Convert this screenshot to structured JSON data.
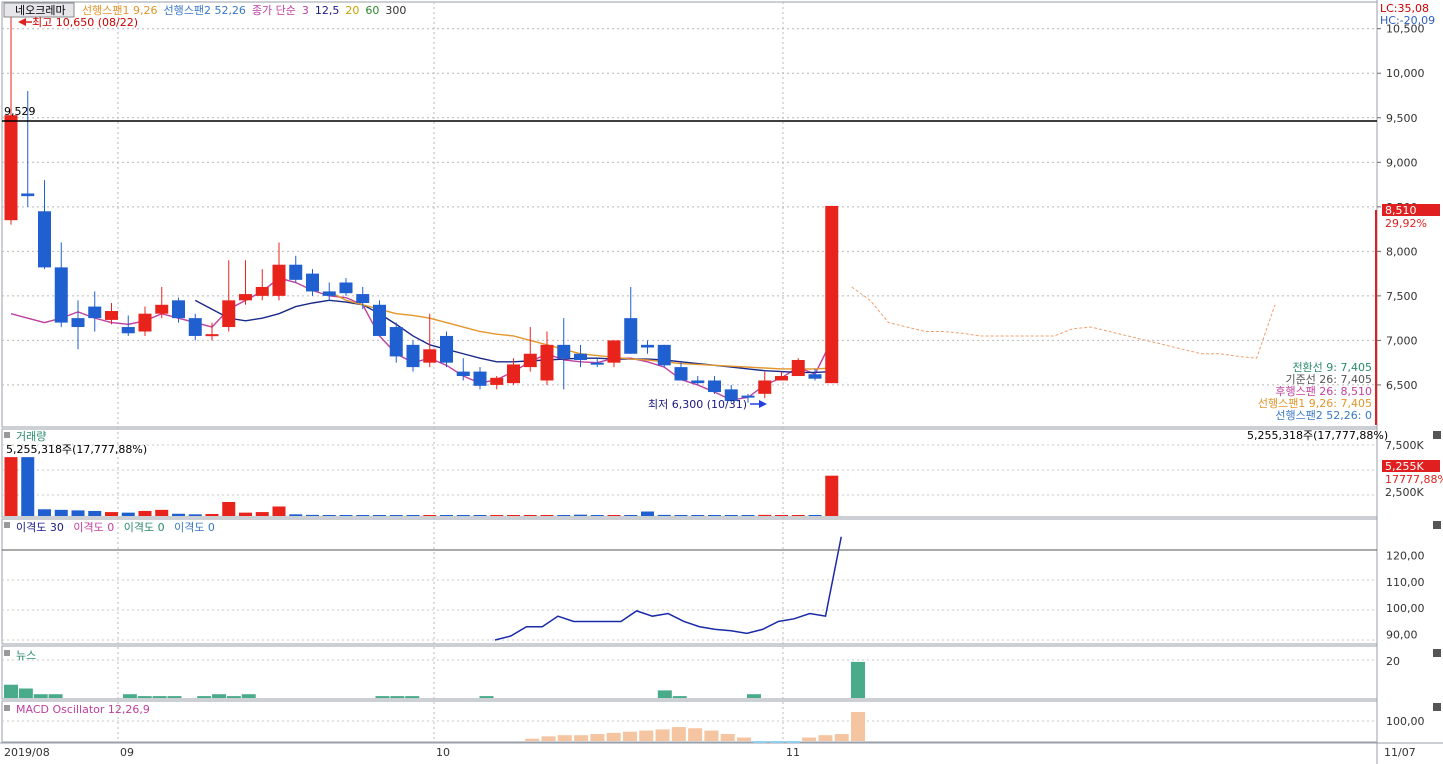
{
  "header": {
    "stock_name": "네오크레마",
    "indicators": [
      {
        "label": "선행스팬1 9,26",
        "color": "#e3962b"
      },
      {
        "label": "선행스팬2 52,26",
        "color": "#3a78c8"
      },
      {
        "label": "종가 단순",
        "color": "#c040a0"
      },
      {
        "label": "3",
        "color": "#c040a0"
      },
      {
        "label": "12,5",
        "color": "#1a1a8a"
      },
      {
        "label": "20",
        "color": "#c8a000"
      },
      {
        "label": "60",
        "color": "#2a8a2a"
      },
      {
        "label": "300",
        "color": "#333333"
      }
    ]
  },
  "annotations": {
    "high": "최고 10,650 (08/22)",
    "low": "최저 6,300 (10/31)",
    "hline_value": "9,529",
    "lc": "LC:35,08",
    "hc": "HC:-20,09",
    "price_tag": "8,510",
    "price_pct": "29,92%"
  },
  "ichimoku_labels": [
    {
      "text": "전환선 9: 7,405",
      "color": "#2a8a6a"
    },
    {
      "text": "기준선 26: 7,405",
      "color": "#555555"
    },
    {
      "text": "후행스팬 26: 8,510",
      "color": "#c040a0"
    },
    {
      "text": "선행스팬1 9,26: 7,405",
      "color": "#e3962b"
    },
    {
      "text": "선행스팬2 52,26: 0",
      "color": "#3a78c8"
    }
  ],
  "panels": {
    "volume": {
      "title": "거래량",
      "left_value": "5,255,318주(17,777,88%)",
      "right_value": "5,255,318주(17,777,88%)",
      "tag": "5,255K",
      "tag_pct": "17777,88%",
      "ticks": [
        "7,500K",
        "2,500K"
      ]
    },
    "disparity": {
      "title_parts": [
        "이격도 30",
        "이격도 0",
        "이격도 0",
        "이격도 0"
      ],
      "ticks": [
        "120,00",
        "110,00",
        "100,00",
        "90,00"
      ]
    },
    "news": {
      "title": "뉴스",
      "ticks": [
        "20"
      ]
    },
    "macd": {
      "title": "MACD Oscillator 12,26,9",
      "ticks": [
        "100,00"
      ]
    }
  },
  "price_axis_ticks": [
    "10,500",
    "10,000",
    "9,500",
    "9,000",
    "8,500",
    "8,000",
    "7,500",
    "7,000",
    "6,500"
  ],
  "date_axis": [
    "2019/08",
    "09",
    "10",
    "11",
    "11/07"
  ],
  "chart_data": {
    "type": "candlestick",
    "y_range": [
      6050,
      10800
    ],
    "candles": [
      {
        "o": 8350,
        "h": 10650,
        "l": 8300,
        "c": 9529
      },
      {
        "o": 8650,
        "h": 9800,
        "l": 8500,
        "c": 8620
      },
      {
        "o": 8450,
        "h": 8800,
        "l": 7800,
        "c": 7820
      },
      {
        "o": 7820,
        "h": 8100,
        "l": 7150,
        "c": 7200
      },
      {
        "o": 7250,
        "h": 7450,
        "l": 6900,
        "c": 7150
      },
      {
        "o": 7380,
        "h": 7550,
        "l": 7100,
        "c": 7250
      },
      {
        "o": 7230,
        "h": 7420,
        "l": 7180,
        "c": 7330
      },
      {
        "o": 7150,
        "h": 7280,
        "l": 7050,
        "c": 7080
      },
      {
        "o": 7100,
        "h": 7380,
        "l": 7050,
        "c": 7300
      },
      {
        "o": 7300,
        "h": 7600,
        "l": 7250,
        "c": 7400
      },
      {
        "o": 7450,
        "h": 7480,
        "l": 7200,
        "c": 7250
      },
      {
        "o": 7250,
        "h": 7300,
        "l": 7000,
        "c": 7050
      },
      {
        "o": 7050,
        "h": 7200,
        "l": 7000,
        "c": 7070
      },
      {
        "o": 7150,
        "h": 7900,
        "l": 7100,
        "c": 7450
      },
      {
        "o": 7450,
        "h": 7900,
        "l": 7400,
        "c": 7520
      },
      {
        "o": 7500,
        "h": 7800,
        "l": 7450,
        "c": 7600
      },
      {
        "o": 7500,
        "h": 8100,
        "l": 7450,
        "c": 7850
      },
      {
        "o": 7850,
        "h": 7950,
        "l": 7650,
        "c": 7680
      },
      {
        "o": 7750,
        "h": 7800,
        "l": 7500,
        "c": 7550
      },
      {
        "o": 7550,
        "h": 7650,
        "l": 7450,
        "c": 7500
      },
      {
        "o": 7650,
        "h": 7700,
        "l": 7500,
        "c": 7530
      },
      {
        "o": 7520,
        "h": 7600,
        "l": 7350,
        "c": 7420
      },
      {
        "o": 7400,
        "h": 7450,
        "l": 7050,
        "c": 7050
      },
      {
        "o": 7150,
        "h": 7200,
        "l": 6750,
        "c": 6820
      },
      {
        "o": 6950,
        "h": 7000,
        "l": 6650,
        "c": 6700
      },
      {
        "o": 6750,
        "h": 7300,
        "l": 6700,
        "c": 6900
      },
      {
        "o": 7050,
        "h": 7100,
        "l": 6700,
        "c": 6750
      },
      {
        "o": 6650,
        "h": 6800,
        "l": 6550,
        "c": 6600
      },
      {
        "o": 6650,
        "h": 6700,
        "l": 6450,
        "c": 6490
      },
      {
        "o": 6500,
        "h": 6600,
        "l": 6450,
        "c": 6580
      },
      {
        "o": 6520,
        "h": 6800,
        "l": 6500,
        "c": 6730
      },
      {
        "o": 6700,
        "h": 7150,
        "l": 6650,
        "c": 6850
      },
      {
        "o": 6550,
        "h": 7100,
        "l": 6500,
        "c": 6950
      },
      {
        "o": 6950,
        "h": 7250,
        "l": 6450,
        "c": 6800
      },
      {
        "o": 6850,
        "h": 6950,
        "l": 6700,
        "c": 6780
      },
      {
        "o": 6750,
        "h": 6800,
        "l": 6700,
        "c": 6740
      },
      {
        "o": 6750,
        "h": 7000,
        "l": 6700,
        "c": 7000
      },
      {
        "o": 7250,
        "h": 7600,
        "l": 6850,
        "c": 6850
      },
      {
        "o": 6950,
        "h": 7000,
        "l": 6850,
        "c": 6920
      },
      {
        "o": 6950,
        "h": 6950,
        "l": 6700,
        "c": 6720
      },
      {
        "o": 6700,
        "h": 6750,
        "l": 6550,
        "c": 6550
      },
      {
        "o": 6550,
        "h": 6600,
        "l": 6500,
        "c": 6520
      },
      {
        "o": 6550,
        "h": 6600,
        "l": 6400,
        "c": 6420
      },
      {
        "o": 6450,
        "h": 6500,
        "l": 6300,
        "c": 6320
      },
      {
        "o": 6380,
        "h": 6400,
        "l": 6300,
        "c": 6360
      },
      {
        "o": 6400,
        "h": 6650,
        "l": 6350,
        "c": 6550
      },
      {
        "o": 6550,
        "h": 6650,
        "l": 6550,
        "c": 6600
      },
      {
        "o": 6600,
        "h": 6800,
        "l": 6600,
        "c": 6780
      },
      {
        "o": 6620,
        "h": 6680,
        "l": 6550,
        "c": 6570
      },
      {
        "o": 6520,
        "h": 8510,
        "l": 6520,
        "c": 8510
      }
    ],
    "series": [
      {
        "name": "후행스팬 26",
        "color": "#c040a0",
        "values": [
          7300,
          7250,
          7200,
          7250,
          7320,
          7250,
          7200,
          7180,
          7220,
          7300,
          7250,
          7200,
          7150,
          7350,
          7450,
          7550,
          7700,
          7650,
          7560,
          7500,
          7480,
          7400,
          7050,
          6850,
          6750,
          6800,
          6720,
          6600,
          6520,
          6560,
          6650,
          6760,
          6850,
          6780,
          6760,
          6750,
          6800,
          6800,
          6760,
          6700,
          6560,
          6500,
          6420,
          6330,
          6360,
          6500,
          6580,
          6700,
          6620,
          7000
        ]
      },
      {
        "name": "전환선 9",
        "color": "#1a2a8a",
        "values": [
          null,
          null,
          null,
          null,
          null,
          null,
          null,
          null,
          null,
          null,
          null,
          7450,
          7350,
          7250,
          7220,
          7250,
          7300,
          7380,
          7420,
          7450,
          7430,
          7400,
          7300,
          7180,
          7050,
          6950,
          6900,
          6850,
          6800,
          6760,
          6760,
          6770,
          6780,
          6790,
          6800,
          6800,
          6790,
          6790,
          6790,
          6780,
          6760,
          6740,
          6720,
          6700,
          6680,
          6660,
          6650,
          6640,
          6640,
          6650
        ]
      },
      {
        "name": "선행스팬1 9,26",
        "color": "#e3962b",
        "values": [
          null,
          null,
          null,
          null,
          null,
          null,
          null,
          null,
          null,
          null,
          null,
          null,
          null,
          null,
          null,
          null,
          null,
          null,
          null,
          7550,
          7450,
          7400,
          7350,
          7300,
          7280,
          7250,
          7200,
          7150,
          7100,
          7070,
          7050,
          7000,
          6950,
          6900,
          6850,
          6830,
          6810,
          6790,
          6780,
          6760,
          6740,
          6730,
          6720,
          6710,
          6700,
          6690,
          6680,
          6680,
          6680,
          6690
        ]
      }
    ],
    "projection": [
      7600,
      7450,
      7200,
      7150,
      7100,
      7100,
      7080,
      7050,
      7050,
      7050,
      7050,
      7050,
      7130,
      7150,
      7100,
      7050,
      7000,
      6950,
      6900,
      6850,
      6850,
      6820,
      6800,
      7400
    ],
    "volume": [
      5255,
      5255,
      600,
      550,
      500,
      450,
      350,
      300,
      450,
      550,
      200,
      150,
      180,
      1250,
      300,
      350,
      850,
      150,
      100,
      80,
      60,
      50,
      40,
      40,
      60,
      40,
      30,
      30,
      30,
      30,
      30,
      80,
      30,
      30,
      120,
      30,
      20,
      30,
      400,
      100,
      50,
      40,
      80,
      30,
      30,
      100,
      30,
      40,
      60,
      3600
    ],
    "volume_max": 7500,
    "disparity": [
      null,
      null,
      null,
      null,
      null,
      null,
      null,
      null,
      null,
      null,
      null,
      null,
      null,
      null,
      null,
      null,
      null,
      null,
      null,
      null,
      null,
      null,
      null,
      null,
      null,
      null,
      null,
      null,
      null,
      88,
      89.5,
      93,
      93,
      97,
      95,
      95,
      95,
      95,
      99,
      97,
      98,
      95,
      93,
      92,
      91.5,
      90.5,
      92,
      95,
      96,
      98,
      97,
      127
    ],
    "news": [
      7,
      5,
      2,
      2,
      0,
      0,
      0,
      0,
      2,
      1,
      1,
      1,
      0,
      1,
      2,
      1,
      2,
      0,
      0,
      0,
      0,
      0,
      0,
      0,
      0,
      1,
      1,
      1,
      0,
      0,
      0,
      0,
      1,
      0,
      0,
      0,
      0,
      0,
      0,
      0,
      0,
      0,
      0,
      0,
      4,
      1,
      0,
      0,
      0,
      0,
      2,
      0,
      0,
      0,
      0,
      0,
      0,
      19
    ],
    "macd": [
      null,
      null,
      null,
      null,
      null,
      null,
      null,
      null,
      null,
      null,
      null,
      null,
      null,
      null,
      null,
      null,
      null,
      null,
      null,
      null,
      null,
      null,
      null,
      null,
      null,
      null,
      null,
      null,
      null,
      null,
      null,
      null,
      2,
      4,
      5,
      5,
      6,
      7,
      8,
      9,
      10,
      12,
      11,
      9,
      6,
      3,
      -2,
      -3,
      -2,
      3,
      5,
      6,
      25
    ]
  }
}
